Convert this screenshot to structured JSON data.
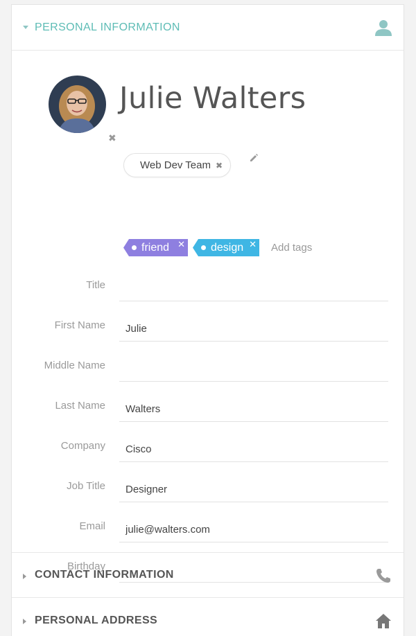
{
  "personal_info": {
    "title": "PERSONAL INFORMATION",
    "name": "Julie Walters",
    "team": "Web Dev Team",
    "tags": [
      {
        "label": "friend",
        "color": "#8e7fe0"
      },
      {
        "label": "design",
        "color": "#3fb6e4"
      }
    ],
    "add_tags_placeholder": "Add tags",
    "fields": [
      {
        "label": "Title",
        "value": ""
      },
      {
        "label": "First Name",
        "value": "Julie"
      },
      {
        "label": "Middle Name",
        "value": ""
      },
      {
        "label": "Last Name",
        "value": "Walters"
      },
      {
        "label": "Company",
        "value": "Cisco"
      },
      {
        "label": "Job Title",
        "value": "Designer"
      },
      {
        "label": "Email",
        "value": "julie@walters.com"
      },
      {
        "label": "Birthday",
        "value": ""
      }
    ],
    "icon": "person-icon"
  },
  "contact_info": {
    "title": "CONTACT INFORMATION",
    "icon": "phone-icon"
  },
  "personal_address": {
    "title": "PERSONAL ADDRESS",
    "icon": "home-icon"
  },
  "colors": {
    "accent": "#5dbcb5",
    "tag_friend": "#8e7fe0",
    "tag_design": "#3fb6e4"
  }
}
